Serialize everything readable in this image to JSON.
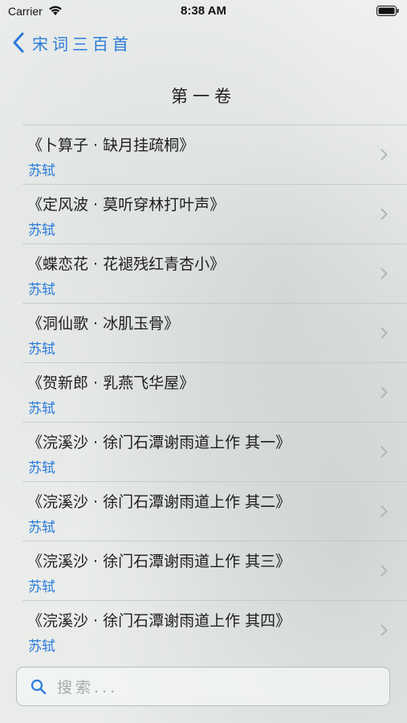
{
  "status_bar": {
    "carrier": "Carrier",
    "time": "8:38 AM"
  },
  "nav": {
    "back_label": "宋词三百首"
  },
  "volume_title": "第一卷",
  "poems": [
    {
      "title": "《卜算子 · 缺月挂疏桐》",
      "author": "苏轼"
    },
    {
      "title": "《定风波 · 莫听穿林打叶声》",
      "author": "苏轼"
    },
    {
      "title": "《蝶恋花 · 花褪残红青杏小》",
      "author": "苏轼"
    },
    {
      "title": "《洞仙歌 · 冰肌玉骨》",
      "author": "苏轼"
    },
    {
      "title": "《贺新郎 · 乳燕飞华屋》",
      "author": "苏轼"
    },
    {
      "title": "《浣溪沙 · 徐门石潭谢雨道上作 其一》",
      "author": "苏轼"
    },
    {
      "title": "《浣溪沙 · 徐门石潭谢雨道上作 其二》",
      "author": "苏轼"
    },
    {
      "title": "《浣溪沙 · 徐门石潭谢雨道上作 其三》",
      "author": "苏轼"
    },
    {
      "title": "《浣溪沙 · 徐门石潭谢雨道上作 其四》",
      "author": "苏轼"
    }
  ],
  "search": {
    "placeholder": "搜索...",
    "value": ""
  },
  "icons": {
    "back": "chevron-left-icon",
    "row_arrow": "chevron-right-icon",
    "search": "magnifier-icon",
    "wifi": "wifi-icon",
    "battery": "battery-icon"
  },
  "colors": {
    "accent": "#2b7bd9",
    "text": "#1e1e1e",
    "separator": "#bec3c3"
  }
}
